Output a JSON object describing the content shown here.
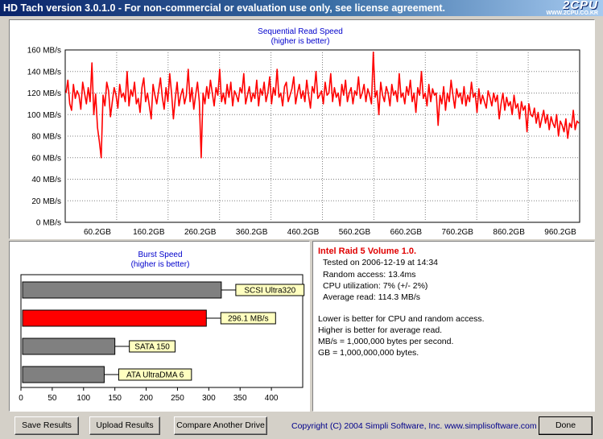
{
  "window": {
    "title": "HD Tach version 3.0.1.0  - For non-commercial or evaluation use only, see license agreement.",
    "watermark": "2CPU",
    "watermark_sub": "WWW.2CPU.CO.KR"
  },
  "colors": {
    "series_red": "#ff0000",
    "bar_gray": "#808080",
    "label_bg": "#ffffc0",
    "title_blue": "#0000cc",
    "info_title_red": "#e00000"
  },
  "chart_data": [
    {
      "type": "line",
      "title": "Sequential Read Speed",
      "subtitle": "(higher is better)",
      "xlabel": "",
      "ylabel": "",
      "x_tick_labels": [
        "60.2GB",
        "160.2GB",
        "260.2GB",
        "360.2GB",
        "460.2GB",
        "560.2GB",
        "660.2GB",
        "760.2GB",
        "860.2GB",
        "960.2GB"
      ],
      "y_tick_labels": [
        "160 MB/s",
        "140 MB/s",
        "120 MB/s",
        "100 MB/s",
        "80 MB/s",
        "60 MB/s",
        "40 MB/s",
        "20 MB/s",
        "0 MB/s"
      ],
      "ylim": [
        0,
        160
      ],
      "xlim": [
        0,
        960.2
      ],
      "grid": true,
      "series": [
        {
          "values": [
            120,
            132,
            110,
            104,
            128,
            115,
            122,
            118,
            105,
            130,
            120,
            110,
            125,
            112,
            148,
            100,
            119,
            88,
            75,
            60,
            118,
            108,
            130,
            122,
            98,
            112,
            125,
            118,
            106,
            128,
            116,
            120,
            112,
            140,
            108,
            123,
            117,
            130,
            110,
            115,
            102,
            125,
            134,
            112,
            120,
            108,
            96,
            128,
            118,
            110,
            122,
            134,
            116,
            105,
            125,
            112,
            138,
            120,
            96,
            115,
            130,
            108,
            118,
            124,
            110,
            118,
            142,
            112,
            125,
            105,
            118,
            130,
            112,
            60,
            120,
            110,
            126,
            115,
            132,
            120,
            108,
            125,
            118,
            142,
            112,
            120,
            110,
            128,
            116,
            130,
            108,
            122,
            118,
            112,
            125,
            120,
            138,
            110,
            118,
            126,
            112,
            120,
            115,
            132,
            108,
            124,
            118,
            130,
            112,
            120,
            135,
            110,
            125,
            118,
            142,
            116,
            120,
            108,
            126,
            130,
            112,
            118,
            124,
            135,
            110,
            120,
            128,
            115,
            122,
            112,
            132,
            118,
            106,
            126,
            120,
            140,
            115,
            118,
            122,
            110,
            130,
            118,
            120,
            138,
            112,
            125,
            116,
            120,
            108,
            128,
            118,
            132,
            112,
            120,
            125,
            110,
            122,
            118,
            135,
            115,
            120,
            128,
            112,
            124,
            118,
            110,
            158,
            116,
            122,
            100,
            130,
            118,
            112,
            126,
            120,
            108,
            128,
            118,
            122,
            112,
            138,
            116,
            120,
            110,
            126,
            118,
            132,
            112,
            120,
            102,
            125,
            118,
            140,
            115,
            120,
            108,
            128,
            112,
            124,
            118,
            120,
            90,
            118,
            110,
            126,
            104,
            120,
            112,
            132,
            118,
            106,
            124,
            116,
            120,
            110,
            126,
            108,
            118,
            112,
            130,
            116,
            120,
            102,
            124,
            110,
            118,
            112,
            106,
            122,
            116,
            108,
            120,
            112,
            118,
            96,
            110,
            120,
            104,
            116,
            108,
            112,
            100,
            118,
            106,
            110,
            96,
            112,
            104,
            108,
            84,
            110,
            100,
            98,
            106,
            92,
            102,
            88,
            96,
            104,
            92,
            100,
            86,
            98,
            92,
            88,
            100,
            80,
            94,
            90,
            84,
            96,
            78,
            92,
            88,
            104,
            86,
            94,
            92
          ]
        }
      ]
    },
    {
      "type": "bar",
      "orientation": "horizontal",
      "title": "Burst Speed",
      "subtitle": "(higher is better)",
      "xlim": [
        0,
        450
      ],
      "x_tick_labels": [
        "0",
        "50",
        "100",
        "150",
        "200",
        "250",
        "300",
        "350",
        "400"
      ],
      "categories": [
        "SCSI Ultra320",
        "296.1 MB/s",
        "SATA 150",
        "ATA UltraDMA 6"
      ],
      "values": [
        320,
        296.1,
        150,
        133
      ],
      "bar_colors": [
        "#808080",
        "#ff0000",
        "#808080",
        "#808080"
      ]
    }
  ],
  "results": {
    "drive_name": "Intel Raid 5 Volume 1.0.",
    "tested_on": "Tested on 2006-12-19 at 14:34",
    "random_access": "Random access: 13.4ms",
    "cpu_utilization": "CPU utilization: 7% (+/- 2%)",
    "average_read": "Average read: 114.3 MB/s",
    "note1": "Lower is better for CPU and random access.",
    "note2": "Higher is better for average read.",
    "note3": "MB/s = 1,000,000 bytes per second.",
    "note4": "GB = 1,000,000,000 bytes."
  },
  "footer": {
    "save_label": "Save Results",
    "upload_label": "Upload Results",
    "compare_label": "Compare Another Drive",
    "copyright": "Copyright (C) 2004 Simpli Software, Inc. www.simplisoftware.com",
    "done_label": "Done"
  }
}
